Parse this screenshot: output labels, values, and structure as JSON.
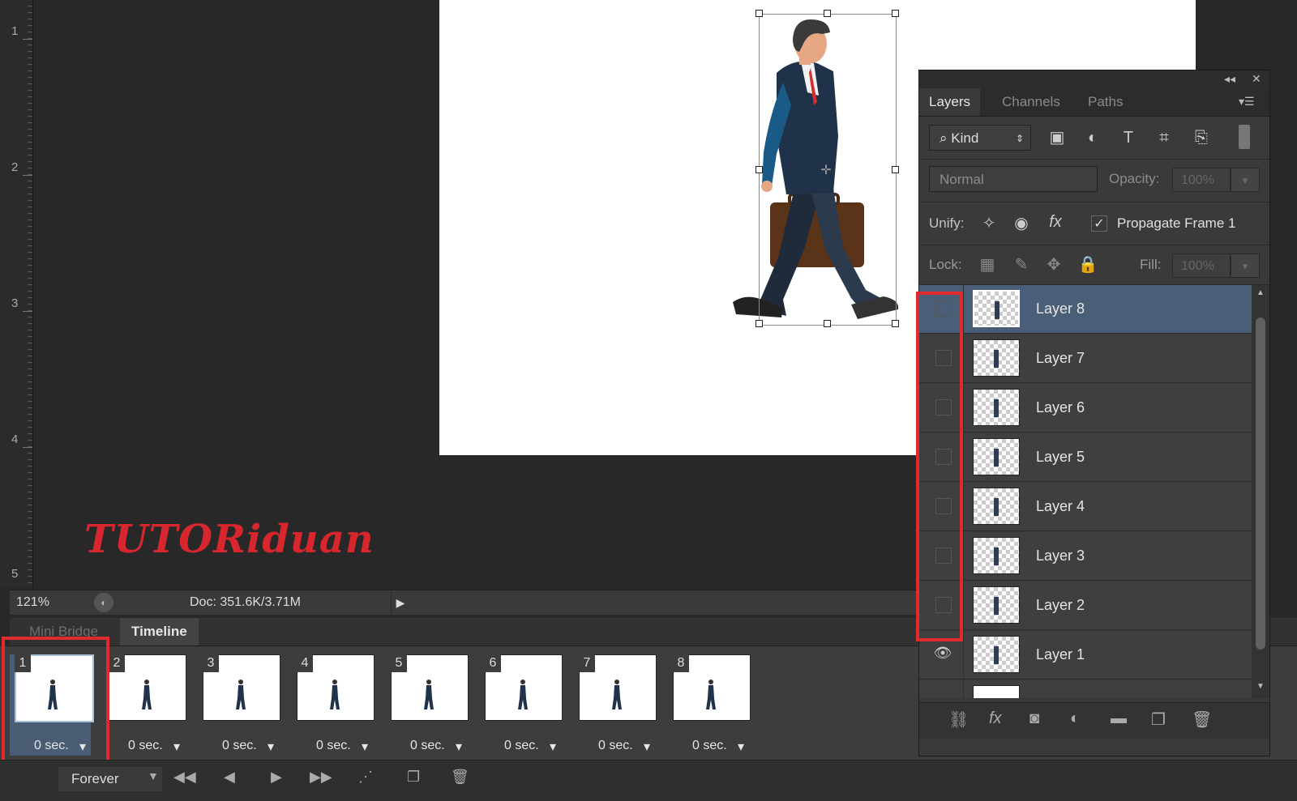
{
  "ruler": {
    "marks": [
      "1",
      "2",
      "3",
      "4",
      "5"
    ]
  },
  "watermark": "TUTORiduan",
  "status": {
    "zoom": "121%",
    "doc": "Doc: 351.6K/3.71M"
  },
  "bottom_tabs": [
    "Mini Bridge",
    "Timeline"
  ],
  "frames": [
    {
      "num": "1",
      "delay": "0 sec."
    },
    {
      "num": "2",
      "delay": "0 sec."
    },
    {
      "num": "3",
      "delay": "0 sec."
    },
    {
      "num": "4",
      "delay": "0 sec."
    },
    {
      "num": "5",
      "delay": "0 sec."
    },
    {
      "num": "6",
      "delay": "0 sec."
    },
    {
      "num": "7",
      "delay": "0 sec."
    },
    {
      "num": "8",
      "delay": "0 sec."
    }
  ],
  "timeline_controls": {
    "loop": "Forever"
  },
  "panel": {
    "tabs": [
      "Layers",
      "Channels",
      "Paths"
    ],
    "filter": {
      "kind": "Kind"
    },
    "blend_mode": "Normal",
    "opacity_label": "Opacity:",
    "opacity_value": "100%",
    "unify_label": "Unify:",
    "propagate_label": "Propagate Frame 1",
    "lock_label": "Lock:",
    "fill_label": "Fill:",
    "fill_value": "100%",
    "layers": [
      {
        "name": "Layer 8",
        "visible": false,
        "selected": true
      },
      {
        "name": "Layer 7",
        "visible": false,
        "selected": false
      },
      {
        "name": "Layer 6",
        "visible": false,
        "selected": false
      },
      {
        "name": "Layer 5",
        "visible": false,
        "selected": false
      },
      {
        "name": "Layer 4",
        "visible": false,
        "selected": false
      },
      {
        "name": "Layer 3",
        "visible": false,
        "selected": false
      },
      {
        "name": "Layer 2",
        "visible": false,
        "selected": false
      },
      {
        "name": "Layer 1",
        "visible": true,
        "selected": false
      }
    ]
  },
  "colors": {
    "accent_red": "#e02a2f",
    "selection_blue": "#4b5e78",
    "panel_bg": "#3a3a3a"
  }
}
